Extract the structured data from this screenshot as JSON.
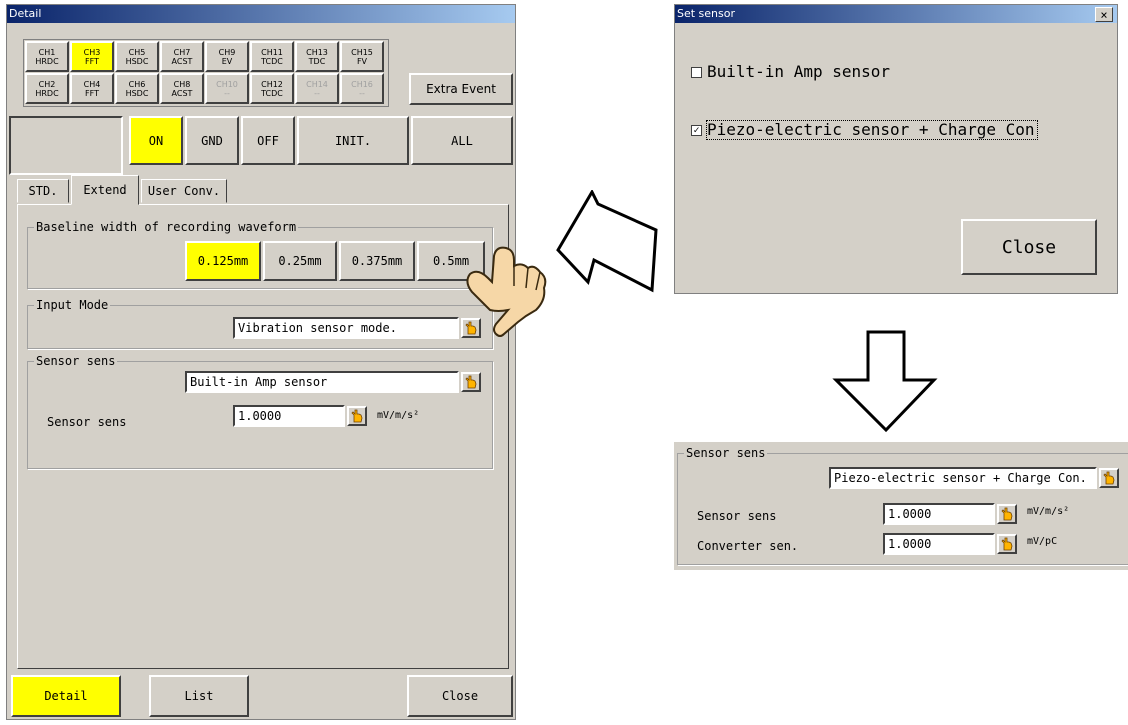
{
  "detail_window": {
    "title": "Detail",
    "channels_row1": [
      {
        "label": "CH1\nHRDC",
        "state": "normal"
      },
      {
        "label": "CH3\nFFT",
        "state": "selected"
      },
      {
        "label": "CH5\nHSDC",
        "state": "normal"
      },
      {
        "label": "CH7\nACST",
        "state": "normal"
      },
      {
        "label": "CH9\nEV",
        "state": "normal"
      },
      {
        "label": "CH11\nTCDC",
        "state": "normal"
      },
      {
        "label": "CH13\nTDC",
        "state": "normal"
      },
      {
        "label": "CH15\nFV",
        "state": "normal"
      }
    ],
    "channels_row2": [
      {
        "label": "CH2\nHRDC",
        "state": "normal"
      },
      {
        "label": "CH4\nFFT",
        "state": "normal"
      },
      {
        "label": "CH6\nHSDC",
        "state": "normal"
      },
      {
        "label": "CH8\nACST",
        "state": "normal"
      },
      {
        "label": "CH10\n--",
        "state": "disabled"
      },
      {
        "label": "CH12\nTCDC",
        "state": "normal"
      },
      {
        "label": "CH14\n--",
        "state": "disabled"
      },
      {
        "label": "CH16\n--",
        "state": "disabled"
      }
    ],
    "extra_event_label": "Extra Event",
    "mode_buttons": {
      "on": "ON",
      "gnd": "GND",
      "off": "OFF",
      "init": "INIT.",
      "all": "ALL"
    },
    "tabs": {
      "std": "STD.",
      "extend": "Extend",
      "user_conv": "User Conv."
    },
    "baseline": {
      "title": "Baseline width of recording waveform",
      "options": [
        "0.125mm",
        "0.25mm",
        "0.375mm",
        "0.5mm"
      ],
      "selected": "0.125mm"
    },
    "input_mode": {
      "title": "Input Mode",
      "value": "Vibration sensor mode."
    },
    "sensor_sens": {
      "title": "Sensor sens",
      "sensor_type": "Built-in Amp sensor",
      "label": "Sensor sens",
      "value": "1.0000",
      "unit": "mV/m/s²"
    },
    "bottom": {
      "detail": "Detail",
      "list": "List",
      "close": "Close"
    }
  },
  "set_sensor_dialog": {
    "title": "Set sensor",
    "close_x": "×",
    "option1": {
      "label": "Built-in Amp sensor",
      "checked": false
    },
    "option2": {
      "label": "Piezo-electric sensor + Charge Con",
      "checked": true
    },
    "close_label": "Close"
  },
  "result_panel": {
    "title": "Sensor sens",
    "sensor_type": "Piezo-electric sensor + Charge Con.",
    "sensor_label": "Sensor sens",
    "sensor_value": "1.0000",
    "sensor_unit": "mV/m/s²",
    "converter_label": "Converter sen.",
    "converter_value": "1.0000",
    "converter_unit": "mV/pC"
  },
  "colors": {
    "accent": "#ffff00",
    "panel": "#d4d0c8"
  },
  "icons": [
    "hand-pointer-icon",
    "arrow-right-icon",
    "arrow-down-icon",
    "checkbox-icon"
  ]
}
